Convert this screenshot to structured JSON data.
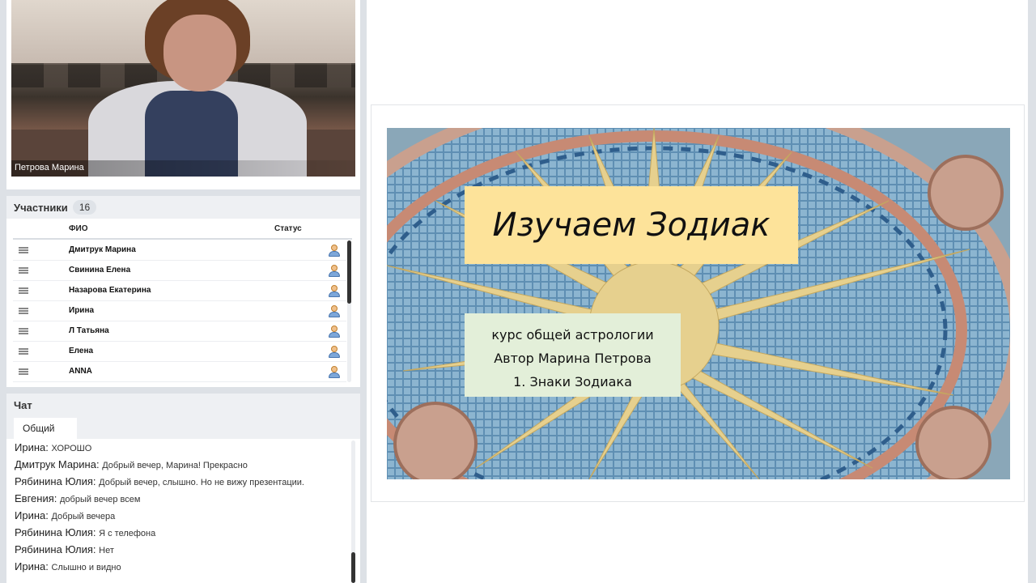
{
  "video": {
    "speaker_name": "Петрова Марина"
  },
  "participants": {
    "title": "Участники",
    "count": "16",
    "columns": {
      "name": "ФИО",
      "status": "Статус"
    },
    "list": [
      {
        "name": "Дмитрук Марина",
        "status_icon": "user-icon"
      },
      {
        "name": "Свинина Елена",
        "status_icon": "user-icon"
      },
      {
        "name": "Назарова Екатерина",
        "status_icon": "user-icon"
      },
      {
        "name": "Ирина",
        "status_icon": "user-icon"
      },
      {
        "name": "Л Татьяна",
        "status_icon": "user-icon"
      },
      {
        "name": "Елена",
        "status_icon": "user-icon"
      },
      {
        "name": "ANNA",
        "status_icon": "user-icon"
      }
    ]
  },
  "chat": {
    "title": "Чат",
    "tab": "Общий",
    "messages": [
      {
        "author": "Ирина:",
        "text": "ХОРОШО"
      },
      {
        "author": "Дмитрук Марина:",
        "text": "Добрый вечер, Марина! Прекрасно"
      },
      {
        "author": "Рябинина Юлия:",
        "text": "Добрый вечер, слышно. Но не вижу презентации."
      },
      {
        "author": "Евгения:",
        "text": "добрый вечер всем"
      },
      {
        "author": "Ирина:",
        "text": "Добрый вечера"
      },
      {
        "author": "Рябинина Юлия:",
        "text": "Я с телефона"
      },
      {
        "author": "Рябинина Юлия:",
        "text": "Нет"
      },
      {
        "author": "Ирина:",
        "text": "Слышно и видно"
      }
    ]
  },
  "slide": {
    "title": "Изучаем Зодиак",
    "lines": [
      "курс общей астрологии",
      "Автор Марина Петрова",
      "1. Знаки Зодиака"
    ]
  }
}
